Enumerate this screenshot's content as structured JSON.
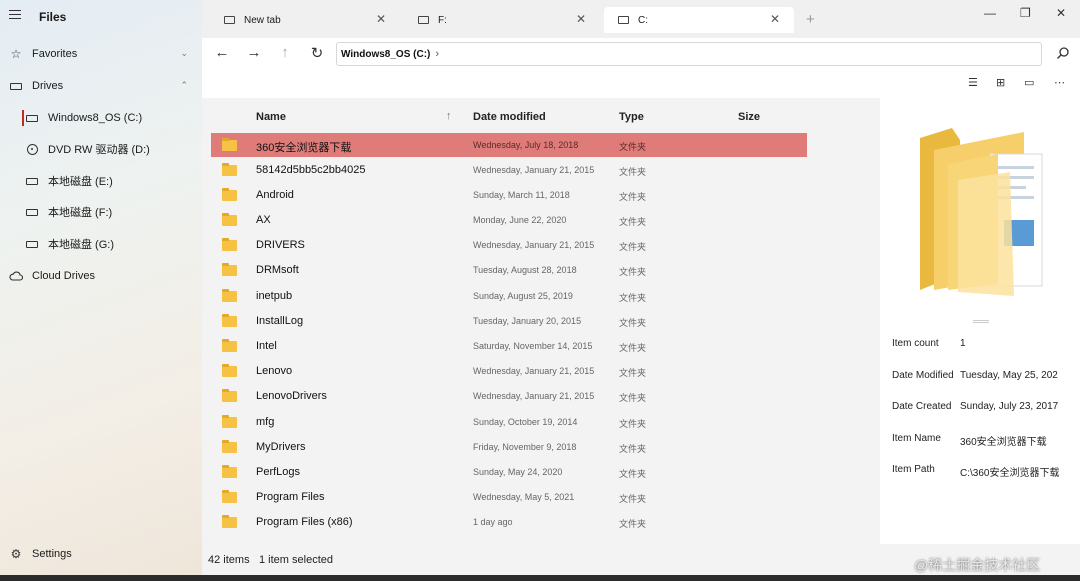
{
  "app": {
    "title": "Files"
  },
  "sidebar": {
    "items": [
      {
        "label": "Favorites",
        "chevron": "⌄"
      },
      {
        "label": "Drives",
        "chevron": "⌃"
      }
    ],
    "drives": [
      {
        "label": "Windows8_OS (C:)",
        "icon": "drive-icon"
      },
      {
        "label": "DVD RW 驱动器 (D:)",
        "icon": "disc-icon"
      },
      {
        "label": "本地磁盘 (E:)",
        "icon": "drive-icon"
      },
      {
        "label": "本地磁盘 (F:)",
        "icon": "drive-icon"
      },
      {
        "label": "本地磁盘 (G:)",
        "icon": "drive-icon"
      }
    ],
    "cloud": "Cloud Drives",
    "settings": "Settings"
  },
  "tabs": [
    {
      "label": "New tab"
    },
    {
      "label": "F:"
    },
    {
      "label": "C:"
    }
  ],
  "address": {
    "crumb": "Windows8_OS (C:)"
  },
  "columns": {
    "name": "Name",
    "date": "Date modified",
    "type": "Type",
    "size": "Size"
  },
  "files": [
    {
      "name": "360安全浏览器下载",
      "date": "Wednesday, July 18, 2018",
      "type": "文件夹"
    },
    {
      "name": "58142d5bb5c2bb4025",
      "date": "Wednesday, January 21, 2015",
      "type": "文件夹"
    },
    {
      "name": "Android",
      "date": "Sunday, March 11, 2018",
      "type": "文件夹"
    },
    {
      "name": "AX",
      "date": "Monday, June 22, 2020",
      "type": "文件夹"
    },
    {
      "name": "DRIVERS",
      "date": "Wednesday, January 21, 2015",
      "type": "文件夹"
    },
    {
      "name": "DRMsoft",
      "date": "Tuesday, August 28, 2018",
      "type": "文件夹"
    },
    {
      "name": "inetpub",
      "date": "Sunday, August 25, 2019",
      "type": "文件夹"
    },
    {
      "name": "InstallLog",
      "date": "Tuesday, January 20, 2015",
      "type": "文件夹"
    },
    {
      "name": "Intel",
      "date": "Saturday, November 14, 2015",
      "type": "文件夹"
    },
    {
      "name": "Lenovo",
      "date": "Wednesday, January 21, 2015",
      "type": "文件夹"
    },
    {
      "name": "LenovoDrivers",
      "date": "Wednesday, January 21, 2015",
      "type": "文件夹"
    },
    {
      "name": "mfg",
      "date": "Sunday, October 19, 2014",
      "type": "文件夹"
    },
    {
      "name": "MyDrivers",
      "date": "Friday, November 9, 2018",
      "type": "文件夹"
    },
    {
      "name": "PerfLogs",
      "date": "Sunday, May 24, 2020",
      "type": "文件夹"
    },
    {
      "name": "Program Files",
      "date": "Wednesday, May 5, 2021",
      "type": "文件夹"
    },
    {
      "name": "Program Files (x86)",
      "date": "1 day ago",
      "type": "文件夹"
    }
  ],
  "preview": {
    "props": [
      {
        "key": "Item count",
        "value": "1"
      },
      {
        "key": "Date Modified",
        "value": "Tuesday, May 25, 202"
      },
      {
        "key": "Date Created",
        "value": "Sunday, July 23, 2017"
      },
      {
        "key": "Item Name",
        "value": "360安全浏览器下载"
      },
      {
        "key": "Item Path",
        "value": "C:\\360安全浏览器下载"
      }
    ]
  },
  "status": {
    "count": "42 items",
    "selected": "1 item selected"
  },
  "watermark": "@稀土掘金技术社区",
  "colors": {
    "selection": "#df7c79",
    "folder": "#f6c244",
    "accent": "#c42b1c"
  }
}
